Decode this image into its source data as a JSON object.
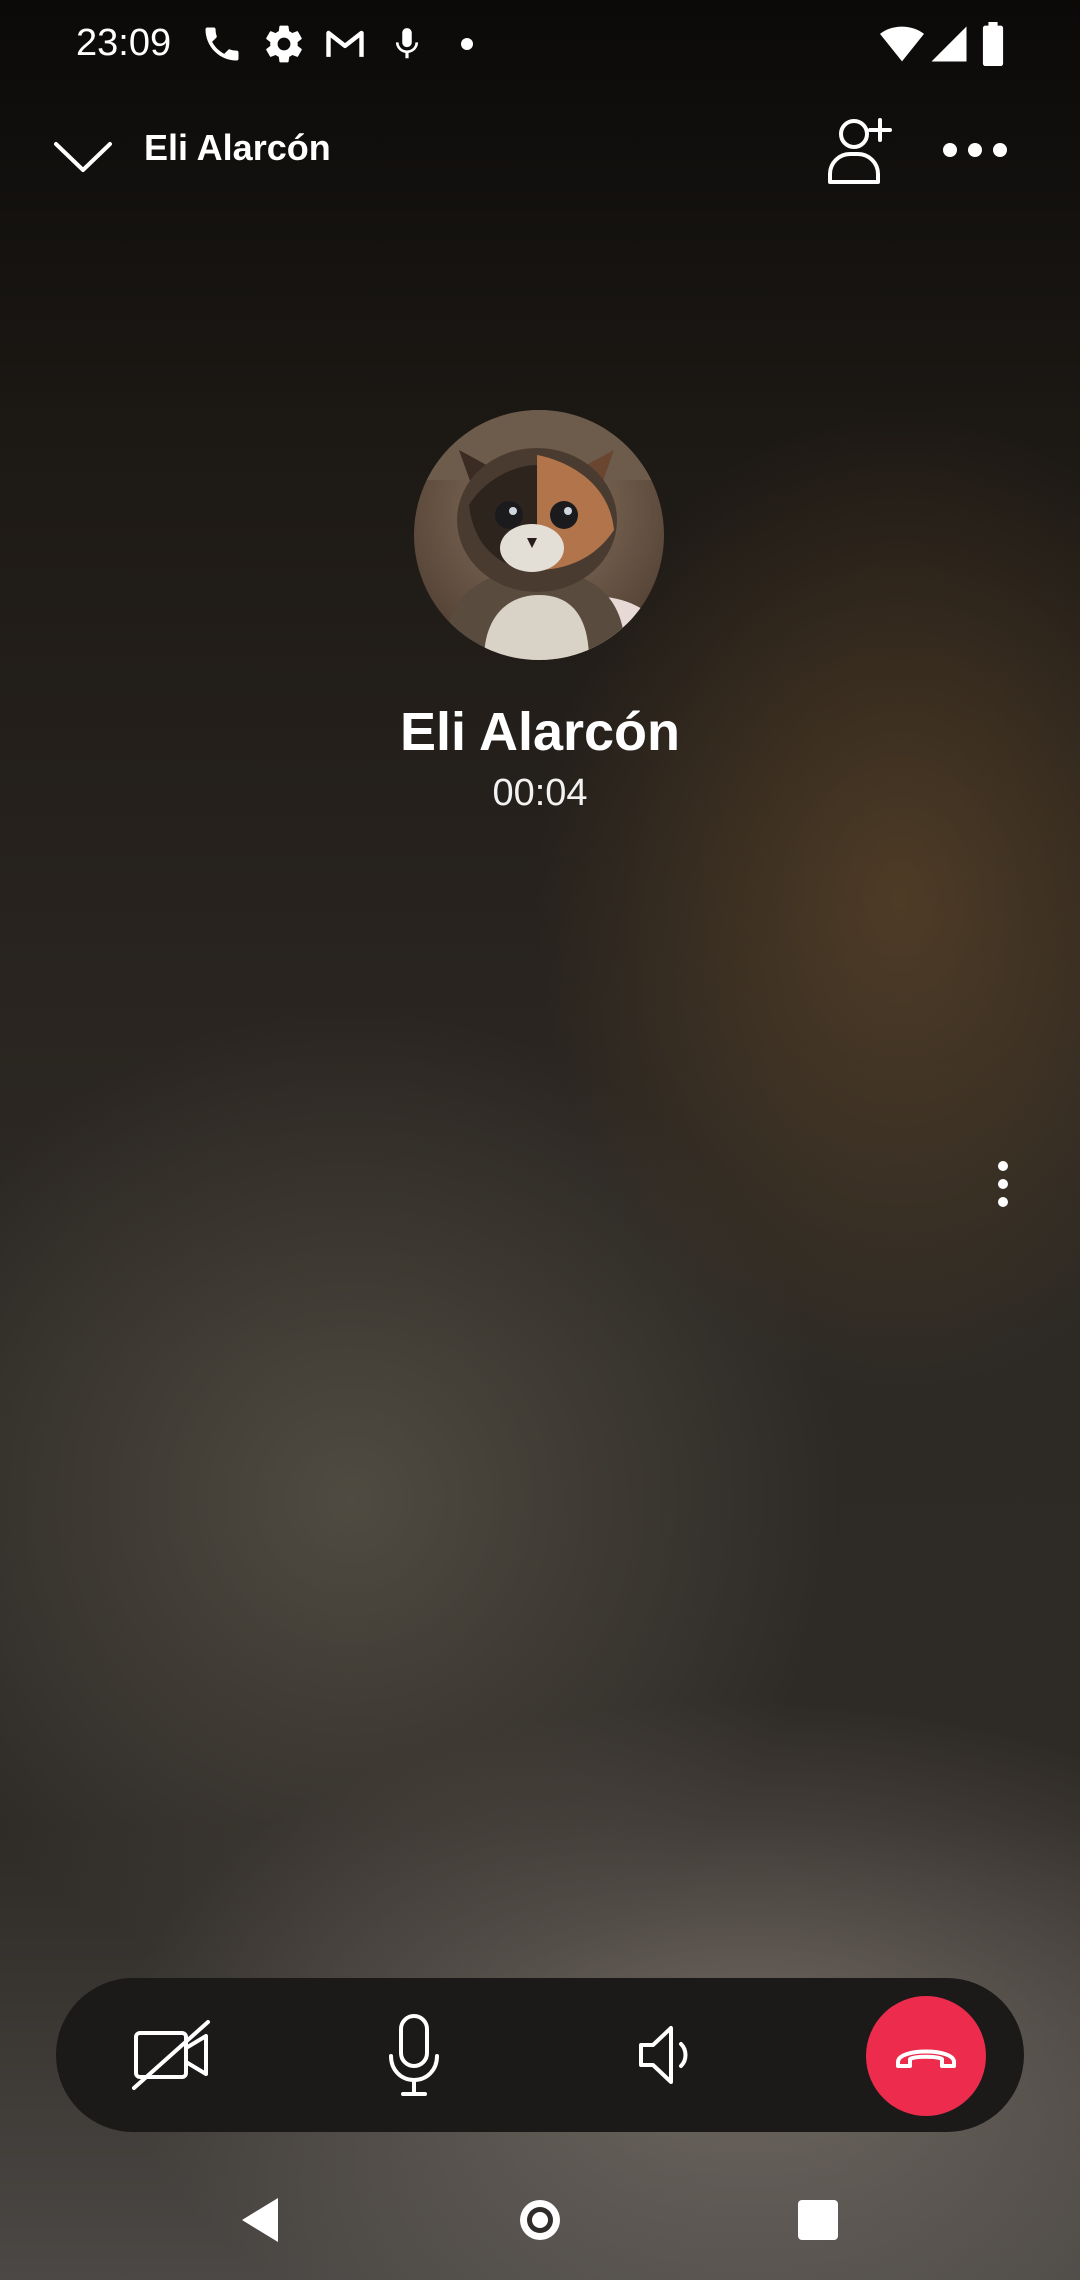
{
  "status_bar": {
    "time": "23:09",
    "notification_icons": [
      "phone-icon",
      "gear-icon",
      "gmail-icon",
      "mic-icon",
      "dot-icon"
    ],
    "system_icons": [
      "wifi-icon",
      "signal-icon",
      "battery-icon"
    ]
  },
  "app_bar": {
    "title": "Eli Alarcón",
    "icons": [
      "chevron-down-icon",
      "add-person-icon",
      "more-horizontal-icon"
    ]
  },
  "caller": {
    "name": "Eli Alarcón",
    "duration": "00:04",
    "avatar": "cat-photo"
  },
  "controls": {
    "buttons": [
      "video-off-icon",
      "microphone-icon",
      "speaker-icon",
      "end-call-icon"
    ],
    "end_call_color": "#ec2b4d"
  },
  "nav_bar": {
    "buttons": [
      "back-icon",
      "home-icon",
      "recents-icon"
    ]
  }
}
